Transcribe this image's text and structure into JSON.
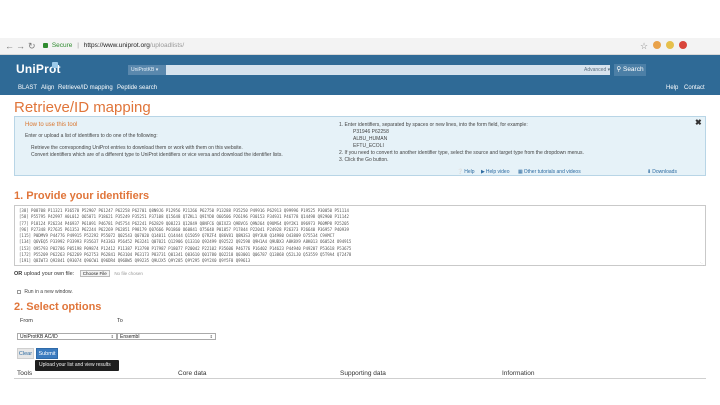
{
  "browser": {
    "secure_label": "Secure",
    "url_host": "https://www.uniprot.org",
    "url_path": "/uploadlists/"
  },
  "header": {
    "logo": "UniProt",
    "db_select": "UniProtKB ▾",
    "advanced": "Advanced ▾",
    "search_button": "Search",
    "nav": {
      "blast": "BLAST",
      "align": "Align",
      "retrieve": "Retrieve/ID mapping",
      "peptide": "Peptide search",
      "help": "Help",
      "contact": "Contact"
    }
  },
  "page": {
    "title": "Retrieve/ID mapping"
  },
  "help_box": {
    "title": "How to use this tool",
    "intro": "Enter or upload a list of identifiers to do one of the following:",
    "bullet1": "Retrieve the corresponding UniProt entries to download them or work with them on this website.",
    "bullet2": "Convert identifiers which are of a different type to UniProt identifiers or vice versa and download the identifier lists.",
    "step1": "1. Enter identifiers, separated by spaces or new lines, into the form field, for example:",
    "examples": [
      "P31946 P62258",
      "ALBU_HUMAN",
      "EFTU_ECOLI"
    ],
    "step2": "2. If you need to convert to another identifier type, select the source and target type from the dropdown menus.",
    "step3": "3. Click the Go button.",
    "links": [
      "Help",
      "Help video",
      "Other tutorials and videos",
      "Downloads"
    ]
  },
  "section1": {
    "title": "1. Provide your identifiers",
    "identifier_lines": [
      "[38] P08708 P11321 P36578 P52907 P61247 P62258 P62701 Q8N9J6 P12956 P21266 P62750 P13288 P35250 P49916 P62913 Q99996 P19525 P30050 P51114",
      "[58] P55795 P42997 A0L012 O65071 P18621 P35249 P35251 P37108 Q15648 Q7ZKL1 Q9IYD8 O60506 P26196 P30153 P34931 P46778 Q14498 Q92900 P11142",
      "[77] P18124 P26234 P46937 P61091 P46781 P45754 P62241 P62829 Q08J23 Q12849 Q8NFC6 Q8IXZ3 Q9BVC6 Q9NJ64 Q9UMS4 Q9Y2K1 O96973 P60MP8 P25205",
      "[96] P27348 P27635 P61353 P62244 P62269 P62851 P98179 Q07666 P01860 O60841 O75648 P01857 P17844 P22041 P24928 P26373 P26640 P36957 P40939",
      "[115] P0DMV9 P44776 P49915 P52292 P55072 Q02543 Q07020 Q14011 Q14444 Q15059 Q7RZF4 Q86V81 Q8N3S3 Q9Y3U8 Q14980 O43809 O75534 C9AMC7",
      "[134] Q6VEQ5 P33992 P33993 P35637 P43363 P56452 P63241 Q07021 Q12906 Q13310 Q92499 Q92522 Q92598 Q9H1A4 Q9UBX3 A8K8X9 A8K013 O60524 O94915",
      "[153] O95793 P02786 P05198 P09874 P12412 P11387 P13798 P17987 P18077 P20042 P22102 P35606 P46776 P16402 P14623 P44940 P49207 P53618 P53675",
      "[172] P55209 P62263 P62269 P62753 P62841 P63104 P63173 P83731 Q01341 Q03610 Q01780 Q02218 Q03001 Q06787 Q13868 Q52LJ0 Q53559 Q5T9A4 Q72478",
      "[191] Q8IWT3 Q92841 Q93074 Q96CW1 Q96DR4 Q96BW5 Q99235 Q9UJX5 Q9Y285 Q9Y295 Q9Y2X0 Q9Y5F8 Q99613"
    ],
    "upload_label": "OR",
    "upload_text": "upload your own file:",
    "choose_file": "Choose File",
    "no_file": "No file chosen",
    "new_window": "Run in a new window."
  },
  "section2": {
    "title": "2. Select options",
    "from_label": "From",
    "to_label": "To",
    "from_value": "UniProtKB AC/ID",
    "to_value": "Ensembl",
    "clear": "Clear",
    "submit": "Submit",
    "tooltip": "Upload your list and view results"
  },
  "table_head": {
    "tools": "Tools",
    "core": "Core data",
    "supporting": "Supporting data",
    "information": "Information"
  },
  "colors": {
    "header": "#2f6a96",
    "accent": "#e0753a",
    "submit": "#3b7bbf"
  }
}
